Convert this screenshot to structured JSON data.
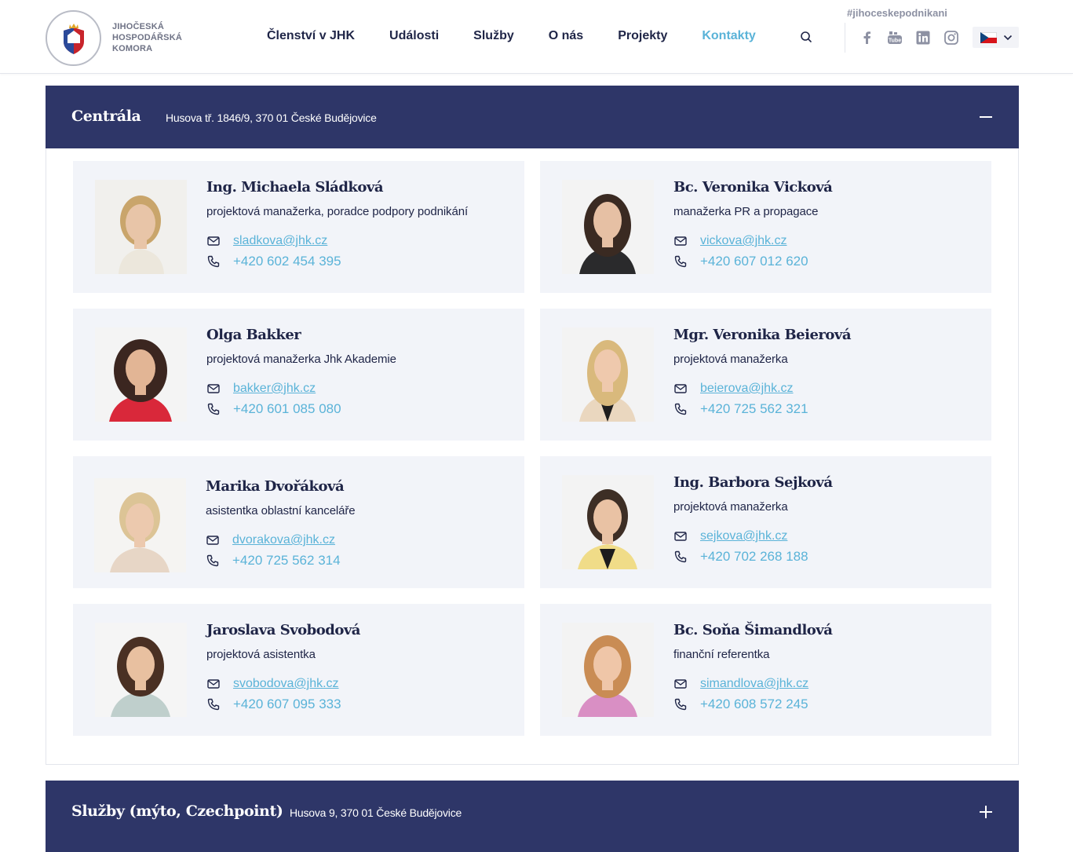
{
  "header": {
    "logo_lines": [
      "JIHOČESKÁ",
      "HOSPODÁŘSKÁ",
      "KOMORA"
    ],
    "hashtag": "#jihoceskepodnikani",
    "nav": [
      {
        "label": "Členství v JHK",
        "active": false
      },
      {
        "label": "Události",
        "active": false
      },
      {
        "label": "Služby",
        "active": false
      },
      {
        "label": "O nás",
        "active": false
      },
      {
        "label": "Projekty",
        "active": false
      },
      {
        "label": "Kontakty",
        "active": true
      }
    ],
    "social_icons": [
      "facebook-icon",
      "youtube-icon",
      "linkedin-icon",
      "instagram-icon"
    ],
    "language_flag": "czech-flag-icon"
  },
  "colors": {
    "accent": "#5ab3d8",
    "navy": "#2e3668",
    "text": "#1f2547",
    "card_bg": "#f2f4f9"
  },
  "sections": [
    {
      "title": "Centrála",
      "address": "Husova tř. 1846/9, 370 01 České Budějovice",
      "expanded": true,
      "toggle_icon": "minus-icon",
      "contacts": [
        {
          "name": "Ing. Michaela Sládková",
          "role": "projektová manažerka, poradce podpory podnikání",
          "email": "sladkova@jhk.cz",
          "phone": "+420 602 454 395"
        },
        {
          "name": "Bc. Veronika Vicková",
          "role": "manažerka PR a propagace",
          "email": "vickova@jhk.cz",
          "phone": "+420 607 012 620"
        },
        {
          "name": "Olga Bakker",
          "role": "projektová manažerka Jhk Akademie",
          "email": "bakker@jhk.cz",
          "phone": "+420 601 085 080"
        },
        {
          "name": "Mgr. Veronika Beierová",
          "role": "projektová manažerka",
          "email": "beierova@jhk.cz",
          "phone": "+420 725 562 321"
        },
        {
          "name": "Marika Dvořáková",
          "role": "asistentka oblastní kanceláře",
          "email": "dvorakova@jhk.cz",
          "phone": "+420 725 562 314"
        },
        {
          "name": "Ing. Barbora Sejková",
          "role": "projektová manažerka",
          "email": "sejkova@jhk.cz",
          "phone": "+420 702 268 188"
        },
        {
          "name": "Jaroslava Svobodová",
          "role": "projektová asistentka",
          "email": "svobodova@jhk.cz",
          "phone": "+420 607 095 333"
        },
        {
          "name": "Bc. Soňa Šimandlová",
          "role": "finanční referentka",
          "email": "simandlova@jhk.cz",
          "phone": "+420 608 572 245"
        }
      ]
    },
    {
      "title": "Služby (mýto, Czechpoint)",
      "address": "Husova 9, 370 01 České Budějovice",
      "expanded": false,
      "toggle_icon": "plus-icon"
    }
  ]
}
